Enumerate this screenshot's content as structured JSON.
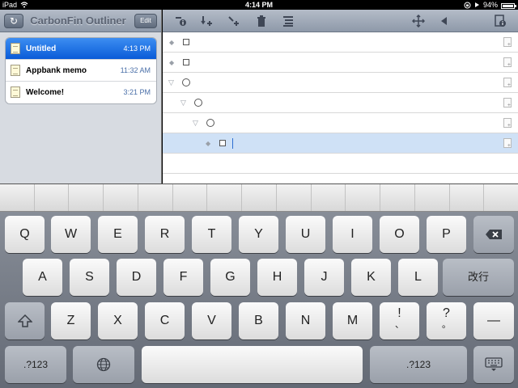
{
  "status_bar": {
    "device": "iPad",
    "time": "4:14 PM",
    "battery": "94%"
  },
  "sidebar": {
    "title": "CarbonFin Outliner",
    "edit_label": "Edit",
    "documents": [
      {
        "name": "Untitled",
        "time": "4:13 PM",
        "selected": true
      },
      {
        "name": "Appbank memo",
        "time": "11:32 AM",
        "selected": false
      },
      {
        "name": "Welcome!",
        "time": "3:21 PM",
        "selected": false
      }
    ]
  },
  "toolbar": {
    "icons": [
      "info-row-icon",
      "indent-add-icon",
      "outdent-add-icon",
      "trash-icon",
      "list-icon",
      "move-icon",
      "back-arrow-icon",
      "document-info-icon"
    ]
  },
  "outline": {
    "rows": [
      {
        "marker": "square",
        "toggle": "diamond",
        "level": 0
      },
      {
        "marker": "square",
        "toggle": "diamond",
        "level": 0
      },
      {
        "marker": "circle",
        "toggle": "triangle",
        "level": 0
      },
      {
        "marker": "circle",
        "toggle": "triangle",
        "level": 1
      },
      {
        "marker": "circle",
        "toggle": "triangle",
        "level": 2
      },
      {
        "marker": "square",
        "toggle": "diamond",
        "level": 3,
        "selected": true
      }
    ]
  },
  "keyboard": {
    "row1": [
      "Q",
      "W",
      "E",
      "R",
      "T",
      "Y",
      "U",
      "I",
      "O",
      "P"
    ],
    "row2": [
      "A",
      "S",
      "D",
      "F",
      "G",
      "H",
      "J",
      "K",
      "L"
    ],
    "return_label": "改行",
    "row3": [
      "Z",
      "X",
      "C",
      "V",
      "B",
      "N",
      "M"
    ],
    "punct1_top": "!",
    "punct1_bottom": "、",
    "punct2_top": "?",
    "punct2_bottom": "。",
    "dash_label": "—",
    "numbers_label": ".?123",
    "numbers_label_right": ".?123",
    "globe_icon": "globe-icon",
    "hide_icon": "keyboard-hide-icon"
  }
}
